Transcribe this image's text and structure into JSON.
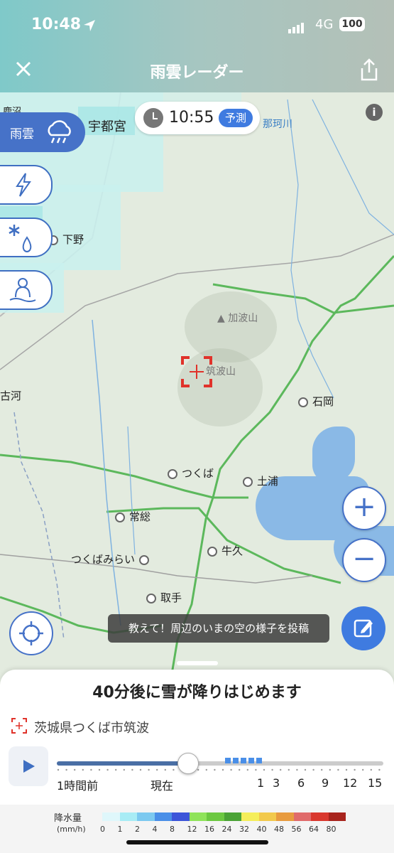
{
  "status": {
    "time": "10:48",
    "network": "4G",
    "battery": "100"
  },
  "header": {
    "title": "雨雲レーダー"
  },
  "time_pill": {
    "time": "10:55",
    "badge": "予測"
  },
  "layers": {
    "rain_label": "雨雲"
  },
  "map_labels": {
    "places": [
      "宇都宮",
      "下野",
      "古河",
      "石岡",
      "つくば",
      "土浦",
      "常総",
      "牛久",
      "つくばみらい",
      "取手"
    ],
    "river": "那珂川",
    "mountains": [
      "加波山",
      "筑波山"
    ],
    "partial": "鹿沼"
  },
  "post": {
    "tip": "教えて！周辺のいまの空の様子を投稿"
  },
  "panel": {
    "forecast": "40分後に雪が降りはじめます",
    "location": "茨城県つくば市筑波",
    "timeline_labels": [
      "1時間前",
      "現在",
      "1",
      "3",
      "6",
      "9",
      "12",
      "15"
    ],
    "progress": 0.4
  },
  "legend": {
    "title": "降水量",
    "unit": "(mm/h)",
    "values": [
      "0",
      "1",
      "2",
      "4",
      "8",
      "12",
      "16",
      "24",
      "32",
      "40",
      "48",
      "56",
      "64",
      "80"
    ],
    "colors": [
      "#dff7fb",
      "#a8ecf5",
      "#7cc9f0",
      "#4a8fe8",
      "#3c55d9",
      "#8fe35a",
      "#6cc841",
      "#4aa236",
      "#f5ee5a",
      "#f2c94c",
      "#e89b3f",
      "#e06b6b",
      "#d9382e",
      "#a8241d"
    ]
  }
}
